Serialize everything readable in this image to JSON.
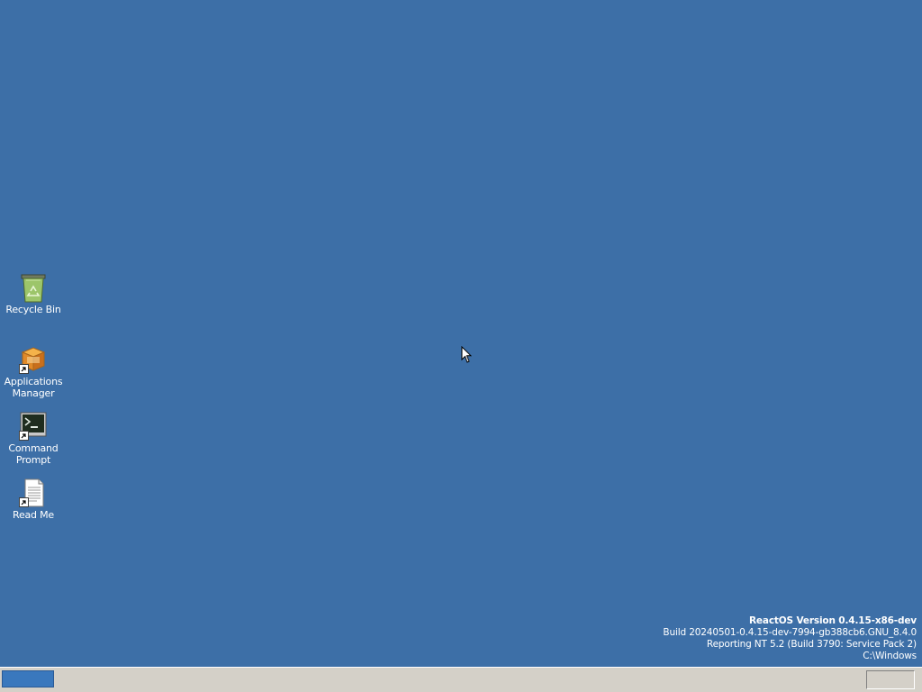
{
  "desktop": {
    "background_color": "#3d6fa7",
    "icons": [
      {
        "label": "Recycle Bin",
        "icon": "recycle-bin-icon"
      },
      {
        "label": "Applications\nManager",
        "icon": "applications-manager-icon"
      },
      {
        "label": "Command\nPrompt",
        "icon": "command-prompt-icon"
      },
      {
        "label": "Read Me",
        "icon": "read-me-icon"
      }
    ]
  },
  "version_info": {
    "title": "ReactOS Version 0.4.15-x86-dev",
    "build": "Build 20240501-0.4.15-dev-7994-gb388cb6.GNU_8.4.0",
    "reporting": "Reporting NT 5.2 (Build 3790: Service Pack 2)",
    "path": "C:\\Windows"
  },
  "taskbar": {
    "background_color": "#d4d0c8",
    "start_button_color": "#3a78bd"
  }
}
